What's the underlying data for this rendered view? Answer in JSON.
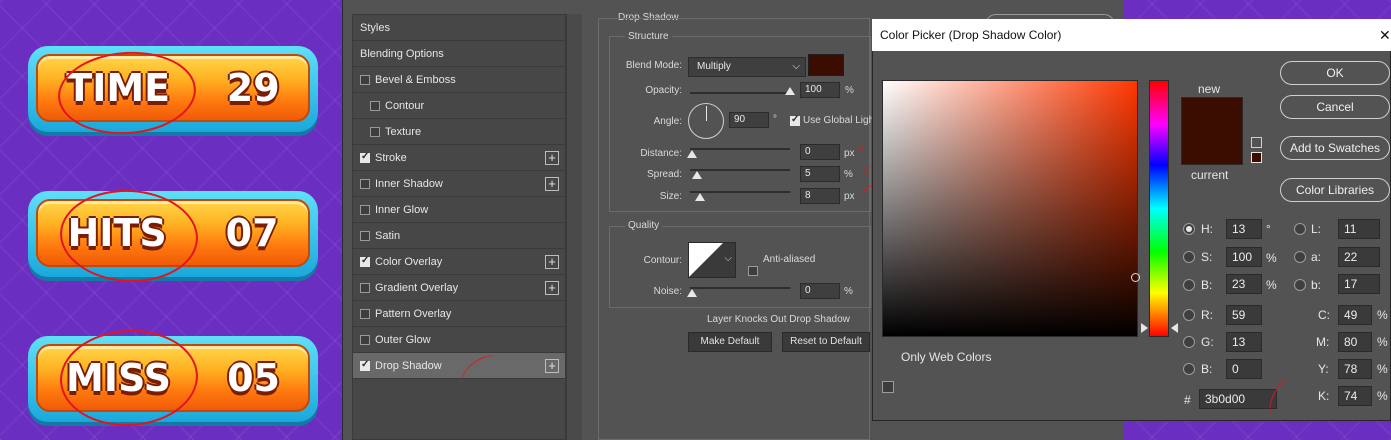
{
  "game": {
    "hud": [
      {
        "label": "TIME",
        "value": "29"
      },
      {
        "label": "HITS",
        "value": "07"
      },
      {
        "label": "MISS",
        "value": "05"
      }
    ]
  },
  "layer_style": {
    "styles_header": "Styles",
    "items": [
      {
        "label": "Blending Options",
        "checkbox": null,
        "plus": false
      },
      {
        "label": "Bevel & Emboss",
        "checkbox": false,
        "plus": false
      },
      {
        "label": "Contour",
        "checkbox": false,
        "plus": false
      },
      {
        "label": "Texture",
        "checkbox": false,
        "plus": false
      },
      {
        "label": "Stroke",
        "checkbox": true,
        "plus": true
      },
      {
        "label": "Inner Shadow",
        "checkbox": false,
        "plus": true
      },
      {
        "label": "Inner Glow",
        "checkbox": false,
        "plus": false
      },
      {
        "label": "Satin",
        "checkbox": false,
        "plus": false
      },
      {
        "label": "Color Overlay",
        "checkbox": true,
        "plus": true
      },
      {
        "label": "Gradient Overlay",
        "checkbox": false,
        "plus": true
      },
      {
        "label": "Pattern Overlay",
        "checkbox": false,
        "plus": false
      },
      {
        "label": "Outer Glow",
        "checkbox": false,
        "plus": false
      },
      {
        "label": "Drop Shadow",
        "checkbox": true,
        "plus": true,
        "selected": true
      }
    ],
    "drop_shadow": {
      "title": "Drop Shadow",
      "structure_label": "Structure",
      "blend_mode_label": "Blend Mode:",
      "blend_mode_value": "Multiply",
      "shadow_color": "#3b0d00",
      "opacity_label": "Opacity:",
      "opacity_value": "100",
      "opacity_level": 1.0,
      "angle_label": "Angle:",
      "angle_value": "90",
      "angle_unit": "°",
      "use_global_light": "Use Global Ligh",
      "distance_label": "Distance:",
      "distance_value": "0",
      "distance_unit": "px",
      "spread_label": "Spread:",
      "spread_value": "5",
      "spread_unit": "%",
      "size_label": "Size:",
      "size_value": "8",
      "size_unit": "px",
      "quality_label": "Quality",
      "contour_label": "Contour:",
      "anti_aliased": "Anti-aliased",
      "noise_label": "Noise:",
      "noise_value": "0",
      "noise_unit": "%",
      "knocks_out": "Layer Knocks Out Drop Shadow",
      "make_default": "Make Default",
      "reset_default": "Reset to Default"
    }
  },
  "color_picker": {
    "title": "Color Picker (Drop Shadow Color)",
    "close": "✕",
    "new_label": "new",
    "current_label": "current",
    "swatch_color": "#3b0d00",
    "ok": "OK",
    "cancel": "Cancel",
    "add_to_swatches": "Add to Swatches",
    "color_libraries": "Color Libraries",
    "only_web_colors": "Only Web Colors",
    "fields": {
      "H": {
        "value": "13",
        "unit": "°"
      },
      "S": {
        "value": "100",
        "unit": "%"
      },
      "B": {
        "value": "23",
        "unit": "%"
      },
      "R": {
        "value": "59"
      },
      "G": {
        "value": "13"
      },
      "Bb": {
        "value": "0"
      },
      "L": {
        "value": "11"
      },
      "a": {
        "value": "22"
      },
      "b": {
        "value": "17"
      },
      "C": {
        "value": "49",
        "unit": "%"
      },
      "M": {
        "value": "80",
        "unit": "%"
      },
      "Y": {
        "value": "78",
        "unit": "%"
      },
      "K": {
        "value": "74",
        "unit": "%"
      }
    },
    "hex_label": "#",
    "hex_value": "3b0d00"
  }
}
